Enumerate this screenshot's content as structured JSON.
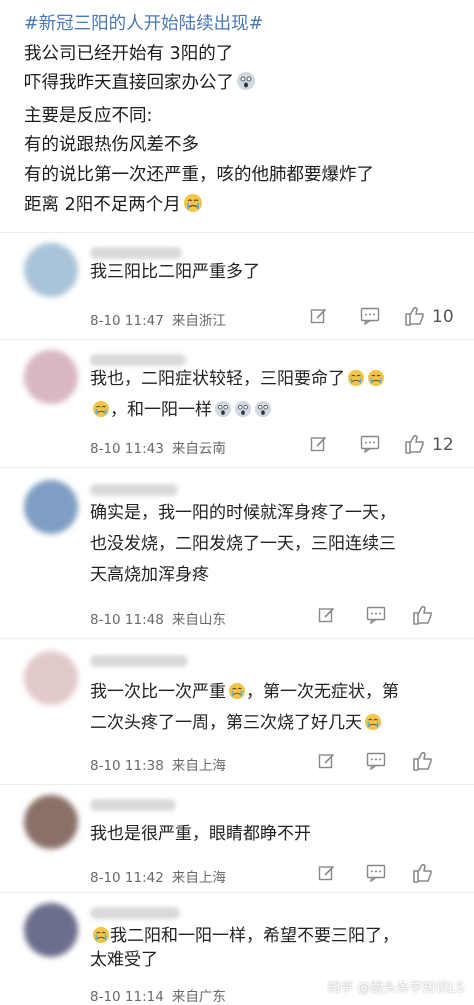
{
  "post": {
    "lines": [
      "#新冠三阳的人开始陆续出现#",
      "我公司已经开始有 3阳的了",
      "吓得我昨天直接回家办公了",
      "主要是反应不同:",
      "有的说跟热伤风差不多",
      "有的说比第一次还严重，咳的他肺都要爆炸了",
      "距离 2阳不足两个月"
    ]
  },
  "comments": [
    {
      "lines": [
        "我三阳比二阳严重多了"
      ],
      "time": "8-10 11:47",
      "location": "来自浙江",
      "likes": "10",
      "avatar_color": "#a9c3d8"
    },
    {
      "lines": [
        "我也，二阳症状较轻，三阳要命了",
        "，和一阳一样"
      ],
      "time": "8-10 11:43",
      "location": "来自云南",
      "likes": "12",
      "avatar_color": "#d8b7c2"
    },
    {
      "lines": [
        "确实是，我一阳的时候就浑身疼了一天，",
        "也没发烧，二阳发烧了一天，三阳连续三",
        "天高烧加浑身疼"
      ],
      "time": "8-10 11:48",
      "location": "来自山东",
      "likes": "",
      "avatar_color": "#7f9ec4"
    },
    {
      "lines": [
        "我一次比一次严重",
        "，第一次无症状，第",
        "二次头疼了一周，第三次烧了好几天"
      ],
      "time": "8-10 11:38",
      "location": "来自上海",
      "likes": "",
      "avatar_color": "#e2c9c9"
    },
    {
      "lines": [
        "我也是很严重，眼睛都睁不开"
      ],
      "time": "8-10 11:42",
      "location": "来自上海",
      "likes": "",
      "avatar_color": "#8a7068"
    },
    {
      "lines": [
        "我二阳和一阳一样，希望不要三阳了，",
        "太难受了"
      ],
      "time": "8-10 11:14",
      "location": "来自广东",
      "likes": "",
      "avatar_color": "#6b6f8c"
    }
  ],
  "watermark": "知乎 @跟头条学知识LS",
  "colors": {
    "hashtag": "#4a78b8",
    "meta": "#6a6a6a",
    "icon": "#888888"
  }
}
